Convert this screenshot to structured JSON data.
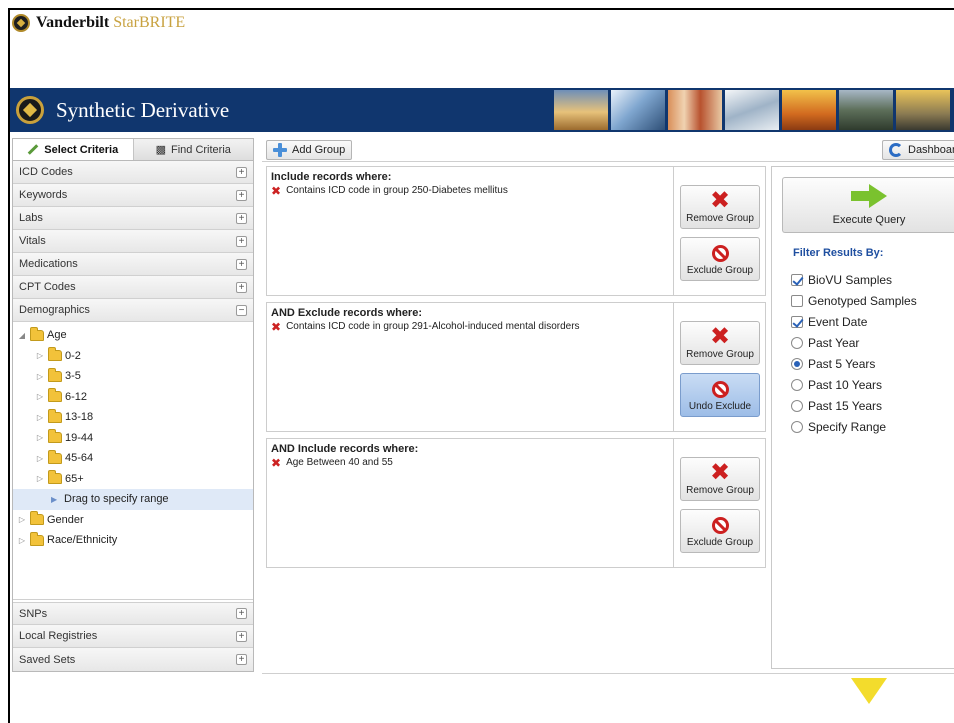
{
  "brand": {
    "name": "Vanderbilt",
    "product": "StarBRITE"
  },
  "header": {
    "title": "Synthetic Derivative"
  },
  "sidebar": {
    "tabs": [
      {
        "label": "Select Criteria"
      },
      {
        "label": "Find Criteria"
      }
    ],
    "categories_top": [
      {
        "label": "ICD Codes",
        "toggle": "+"
      },
      {
        "label": "Keywords",
        "toggle": "+"
      },
      {
        "label": "Labs",
        "toggle": "+"
      },
      {
        "label": "Vitals",
        "toggle": "+"
      },
      {
        "label": "Medications",
        "toggle": "+"
      },
      {
        "label": "CPT Codes",
        "toggle": "+"
      },
      {
        "label": "Demographics",
        "toggle": "−"
      }
    ],
    "tree": {
      "age": "Age",
      "age_ranges": [
        "0-2",
        "3-5",
        "6-12",
        "13-18",
        "19-44",
        "45-64",
        "65+"
      ],
      "drag_hint": "Drag to specify range",
      "gender": "Gender",
      "race": "Race/Ethnicity"
    },
    "categories_bottom": [
      {
        "label": "SNPs",
        "toggle": "+"
      },
      {
        "label": "Local Registries",
        "toggle": "+"
      },
      {
        "label": "Saved Sets",
        "toggle": "+"
      }
    ]
  },
  "toolbar": {
    "add_group": "Add Group",
    "dashboard": "Dashboar"
  },
  "groups": [
    {
      "title": "Include records where:",
      "criterion": "Contains ICD code in group 250-Diabetes mellitus",
      "remove": "Remove Group",
      "exclude": "Exclude Group"
    },
    {
      "title": "AND Exclude records where:",
      "criterion": "Contains ICD code in group 291-Alcohol-induced mental disorders",
      "remove": "Remove Group",
      "exclude": "Undo Exclude"
    },
    {
      "title": "AND Include records where:",
      "criterion": "Age Between 40 and 55",
      "remove": "Remove Group",
      "exclude": "Exclude Group"
    }
  ],
  "right_panel": {
    "execute": "Execute Query",
    "filter_title": "Filter Results By:",
    "checkboxes": [
      {
        "label": "BioVU Samples",
        "checked": true
      },
      {
        "label": "Genotyped Samples",
        "checked": false
      },
      {
        "label": "Event Date",
        "checked": true
      }
    ],
    "radios": [
      {
        "label": "Past Year",
        "selected": false
      },
      {
        "label": "Past 5 Years",
        "selected": true
      },
      {
        "label": "Past 10 Years",
        "selected": false
      },
      {
        "label": "Past 15 Years",
        "selected": false
      },
      {
        "label": "Specify Range",
        "selected": false
      }
    ]
  },
  "colors": {
    "header_bg": "#10366e",
    "accent_blue": "#1f4fa0",
    "remove_red": "#cc2020",
    "execute_green": "#7ac22e",
    "folder": "#f2c23a",
    "mark_yellow": "#f3dc2c"
  }
}
